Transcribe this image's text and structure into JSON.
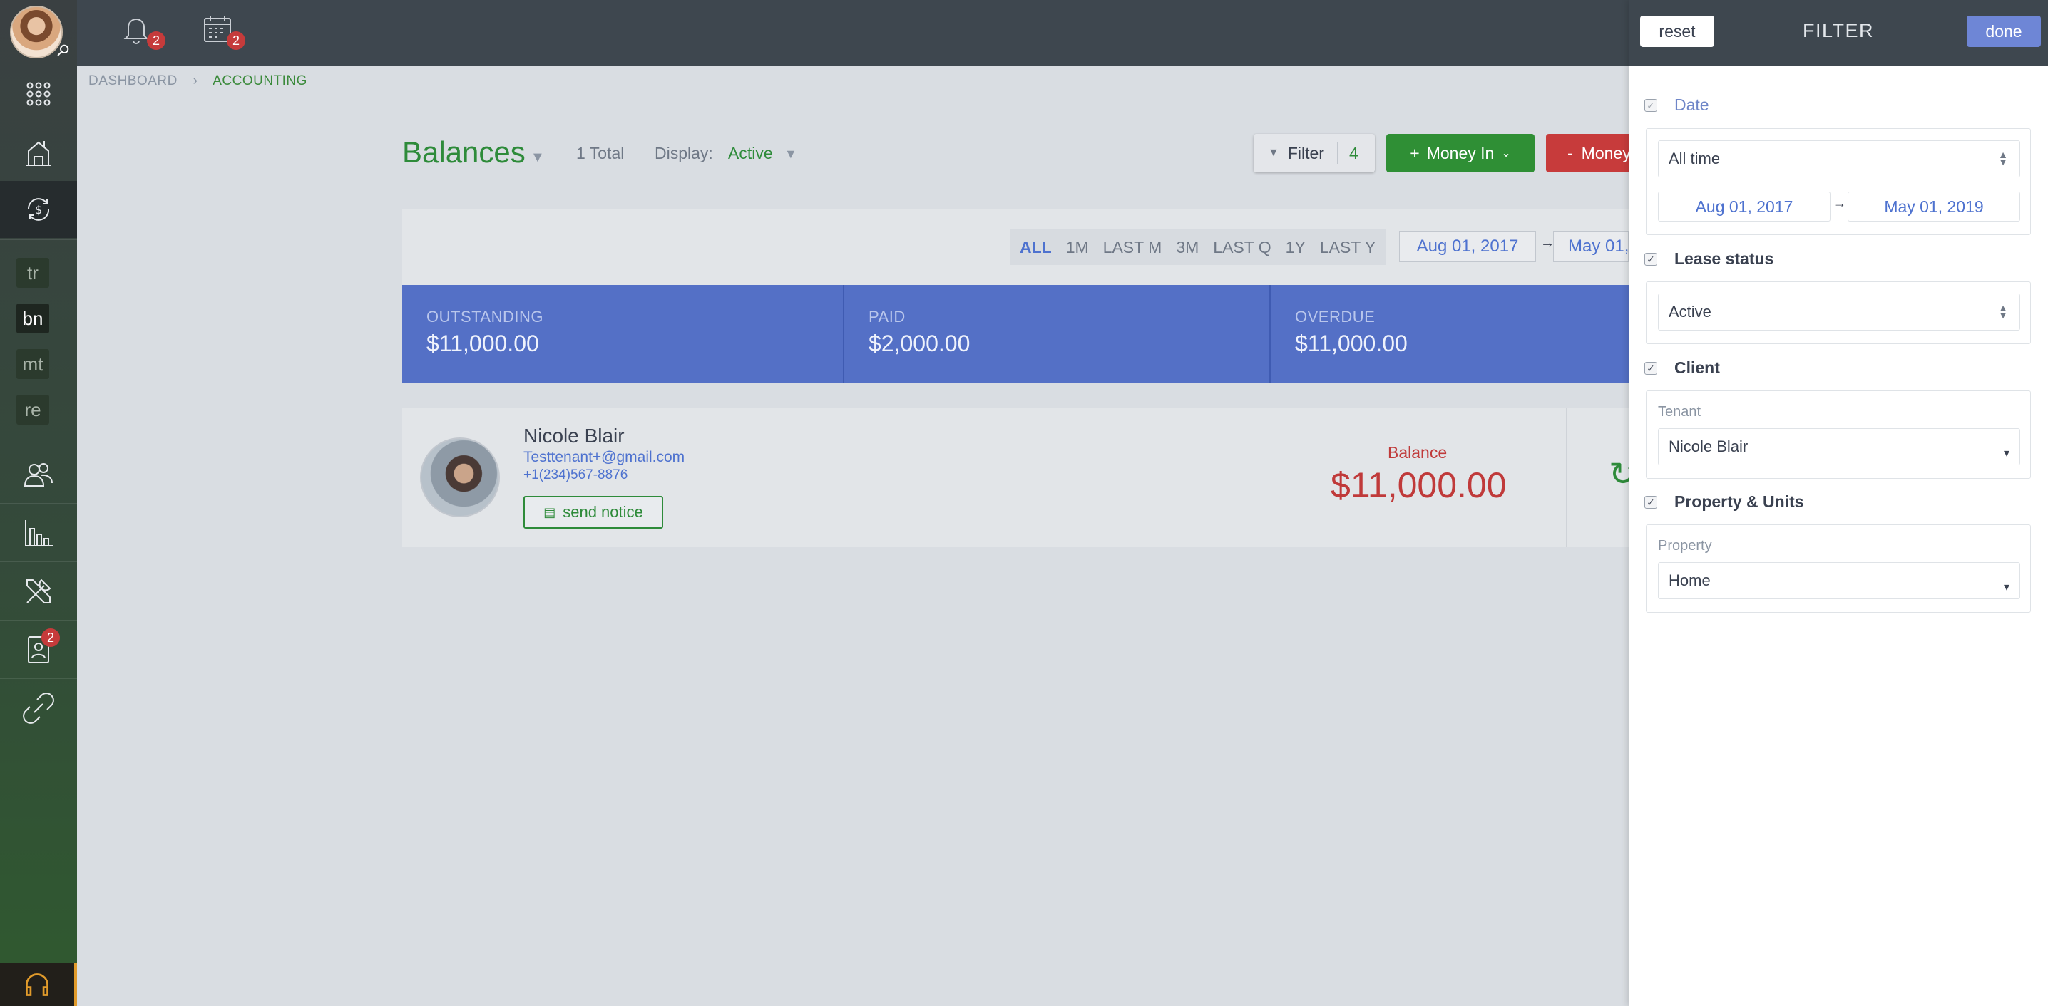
{
  "nav": {
    "notifications_count": "2",
    "calendar_count": "2",
    "sidebar_tags": [
      "tr",
      "bn",
      "mt",
      "re"
    ],
    "reports_badge": "2"
  },
  "breadcrumb": {
    "dashboard": "DASHBOARD",
    "current": "ACCOUNTING"
  },
  "header": {
    "title": "Balances",
    "total": "1 Total",
    "display_label": "Display:",
    "display_value": "Active",
    "filter_label": "Filter",
    "filter_count": "4",
    "money_in": "Money In",
    "money_out": "Money"
  },
  "periods": [
    "ALL",
    "1M",
    "LAST M",
    "3M",
    "LAST Q",
    "1Y",
    "LAST Y"
  ],
  "range": {
    "from": "Aug 01, 2017",
    "to": "May 01,"
  },
  "stats": [
    {
      "label": "OUTSTANDING",
      "value": "$11,000.00"
    },
    {
      "label": "PAID",
      "value": "$2,000.00"
    },
    {
      "label": "OVERDUE",
      "value": "$11,000.00"
    }
  ],
  "tenant": {
    "name": "Nicole Blair",
    "email": "Testtenant+@gmail.com",
    "phone": "+1(234)567-8876",
    "send_notice": "send notice",
    "balance_label": "Balance",
    "balance_value": "$11,000.00"
  },
  "filter_panel": {
    "reset": "reset",
    "title": "FILTER",
    "done": "done",
    "date": {
      "label": "Date",
      "checked": true,
      "select": "All time",
      "from": "Aug 01, 2017",
      "to": "May 01, 2019"
    },
    "lease_status": {
      "label": "Lease status",
      "checked": true,
      "select": "Active"
    },
    "client": {
      "label": "Client",
      "checked": true,
      "sub_label": "Tenant",
      "select": "Nicole Blair"
    },
    "property": {
      "label": "Property & Units",
      "checked": true,
      "sub_label": "Property",
      "select": "Home"
    }
  },
  "colors": {
    "accent_green": "#2e8b3a",
    "accent_blue": "#5470c6",
    "accent_red": "#c03a3a"
  }
}
